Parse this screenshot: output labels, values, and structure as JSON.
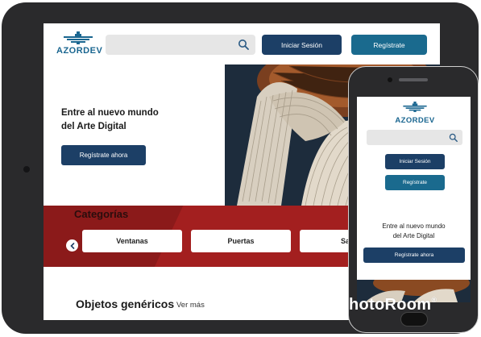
{
  "brand": {
    "name": "AZORDEV",
    "color": "#1a6690"
  },
  "header": {
    "search_placeholder": "",
    "login_label": "Iniciar Sesión",
    "register_label": "Regístrate"
  },
  "hero": {
    "title_line1": "Entre al nuevo mundo",
    "title_line2": "del Arte Digital",
    "cta_label": "Regístrate ahora"
  },
  "categories": {
    "title": "Categorías",
    "items": [
      "Ventanas",
      "Puertas",
      "Sanit"
    ]
  },
  "objects": {
    "title": "Objetos genéricos",
    "more_label": "Ver más"
  },
  "mobile": {
    "brand_name": "AZORDEV",
    "login_label": "Iniciar Sesión",
    "register_label": "Regístrate",
    "hero_title_line1": "Entre al nuevo mundo",
    "hero_title_line2": "del Arte Digital",
    "cta_label": "Regístrate ahora"
  },
  "watermark": {
    "text": "hotoRoom",
    "mark": "®"
  },
  "colors": {
    "navy": "#1c3f66",
    "teal": "#1a6a8e",
    "category_band": "#8b1a1a",
    "device_frame": "#2a2a2c"
  }
}
